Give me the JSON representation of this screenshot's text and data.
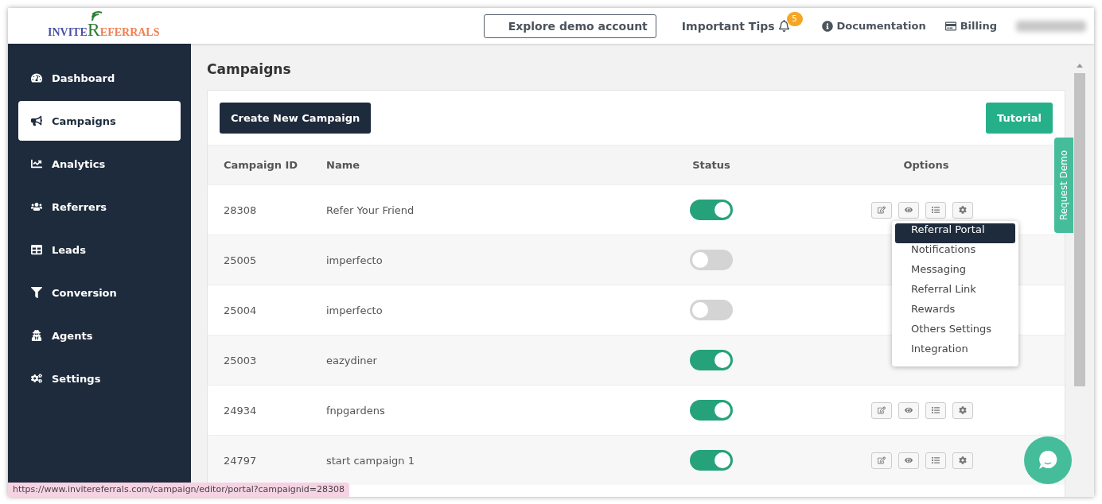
{
  "logo": {
    "first": "INVITE",
    "initial": "R",
    "rest": "EFERRALS"
  },
  "header": {
    "demo_button": "Explore demo account",
    "tips": {
      "label": "Important Tips",
      "badge": "5"
    },
    "links": [
      {
        "kind": "info",
        "label": "Documentation"
      },
      {
        "kind": "card",
        "label": "Billing"
      }
    ]
  },
  "sidebar": {
    "items": [
      {
        "label": "Dashboard",
        "selected": false
      },
      {
        "label": "Campaigns",
        "selected": true
      },
      {
        "label": "Analytics",
        "selected": false
      },
      {
        "label": "Referrers",
        "selected": false
      },
      {
        "label": "Leads",
        "selected": false
      },
      {
        "label": "Conversion",
        "selected": false
      },
      {
        "label": "Agents",
        "selected": false
      },
      {
        "label": "Settings",
        "selected": false
      }
    ]
  },
  "page_title": "Campaigns",
  "actions": {
    "create": "Create New Campaign",
    "tutorial": "Tutorial"
  },
  "table": {
    "columns": [
      "Campaign ID",
      "Name",
      "Status",
      "Options"
    ],
    "rows": [
      {
        "id": "28308",
        "name": "Refer Your Friend",
        "on": true,
        "options_shown": true
      },
      {
        "id": "25005",
        "name": "imperfecto",
        "on": false,
        "options_shown": false
      },
      {
        "id": "25004",
        "name": "imperfecto",
        "on": false,
        "options_shown": false
      },
      {
        "id": "25003",
        "name": "eazydiner",
        "on": true,
        "options_shown": false
      },
      {
        "id": "24934",
        "name": "fnpgardens",
        "on": true,
        "options_shown": true
      },
      {
        "id": "24797",
        "name": "start campaign 1",
        "on": true,
        "options_shown": true
      }
    ]
  },
  "options_menu": {
    "items": [
      {
        "label": "Referral Portal",
        "selected": true
      },
      {
        "label": "Notifications",
        "selected": false
      },
      {
        "label": "Messaging",
        "selected": false
      },
      {
        "label": "Referral Link",
        "selected": false
      },
      {
        "label": "Rewards",
        "selected": false
      },
      {
        "label": "Others Settings",
        "selected": false
      },
      {
        "label": "Integration",
        "selected": false
      }
    ]
  },
  "request_demo": "Request Demo",
  "status_url": "https://www.invitereferrals.com/campaign/editor/portal?campaignid=28308"
}
